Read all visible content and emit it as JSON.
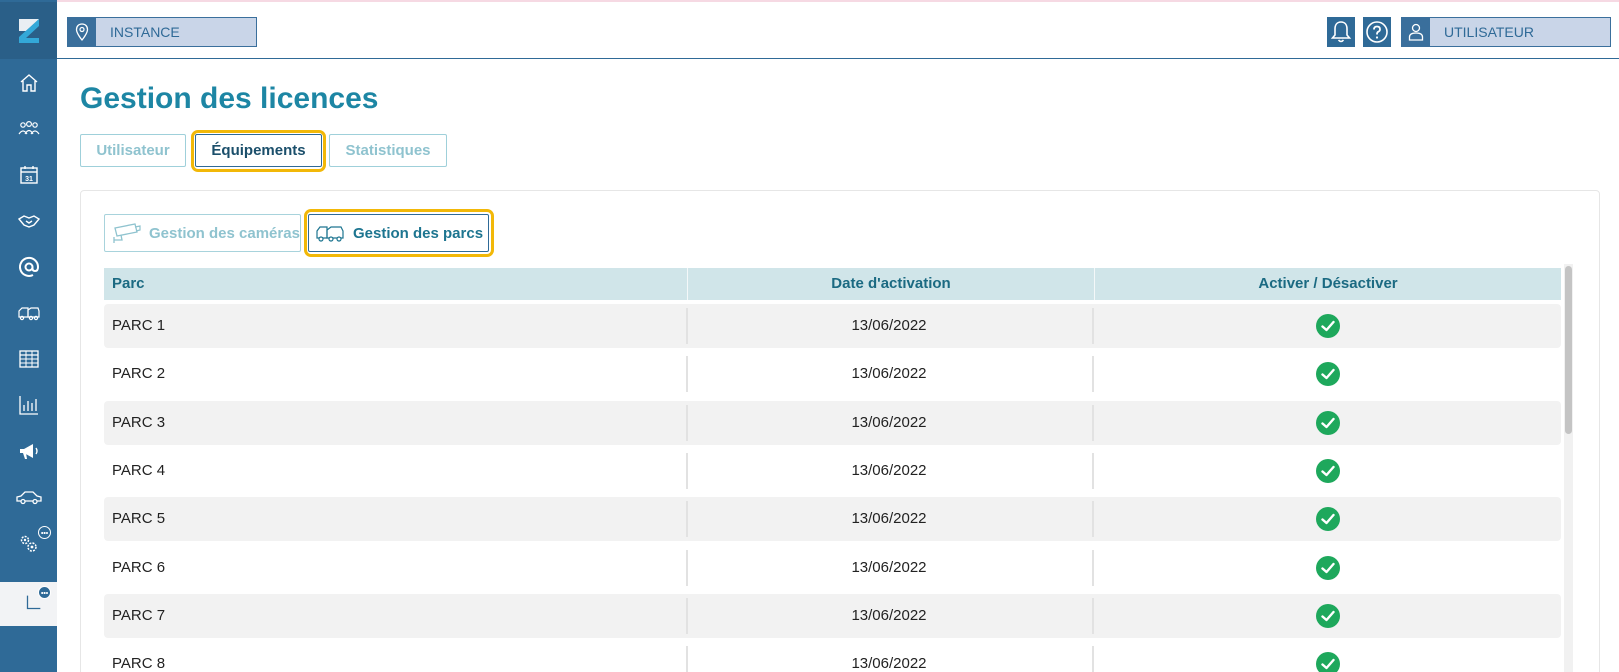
{
  "header": {
    "instance_label": "INSTANCE",
    "user_label": "UTILISATEUR",
    "bell_icon": "bell-icon",
    "help_icon": "help-icon"
  },
  "sidebar": {
    "items": [
      {
        "name": "home",
        "icon": "home-icon"
      },
      {
        "name": "users",
        "icon": "group-icon"
      },
      {
        "name": "calendar",
        "icon": "calendar-icon",
        "text": "31"
      },
      {
        "name": "handshake",
        "icon": "handshake-icon"
      },
      {
        "name": "email",
        "icon": "at-icon"
      },
      {
        "name": "parks",
        "icon": "vehicles-icon"
      },
      {
        "name": "table",
        "icon": "table-icon"
      },
      {
        "name": "stats",
        "icon": "bar-chart-icon"
      },
      {
        "name": "announcements",
        "icon": "megaphone-icon"
      },
      {
        "name": "vehicle",
        "icon": "car-icon"
      },
      {
        "name": "settings",
        "icon": "gears-icon"
      },
      {
        "name": "tools",
        "icon": "tools-icon"
      }
    ]
  },
  "page": {
    "title": "Gestion des licences"
  },
  "tabs": [
    {
      "label": "Utilisateur",
      "active": false
    },
    {
      "label": "Équipements",
      "active": true
    },
    {
      "label": "Statistiques",
      "active": false
    }
  ],
  "subtabs": [
    {
      "label": "Gestion des caméras",
      "icon": "camera-icon",
      "active": false
    },
    {
      "label": "Gestion des parcs",
      "icon": "vehicles-icon",
      "active": true
    }
  ],
  "table": {
    "columns": [
      "Parc",
      "Date d'activation",
      "Activer / Désactiver"
    ],
    "rows": [
      {
        "parc": "PARC 1",
        "date": "13/06/2022",
        "active": true
      },
      {
        "parc": "PARC 2",
        "date": "13/06/2022",
        "active": true
      },
      {
        "parc": "PARC 3",
        "date": "13/06/2022",
        "active": true
      },
      {
        "parc": "PARC 4",
        "date": "13/06/2022",
        "active": true
      },
      {
        "parc": "PARC 5",
        "date": "13/06/2022",
        "active": true
      },
      {
        "parc": "PARC 6",
        "date": "13/06/2022",
        "active": true
      },
      {
        "parc": "PARC 7",
        "date": "13/06/2022",
        "active": true
      },
      {
        "parc": "PARC 8",
        "date": "13/06/2022",
        "active": true
      }
    ]
  },
  "colors": {
    "sidebar": "#2f6a97",
    "title": "#1d86a4",
    "highlight": "#f2b808",
    "check": "#1ea85c",
    "table_header": "#d0e5e9"
  }
}
